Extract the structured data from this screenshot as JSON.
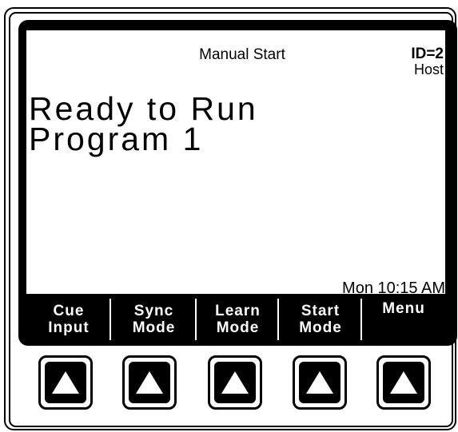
{
  "screen": {
    "title": "Manual Start",
    "id_label": "ID=2",
    "host_label": "Host",
    "message_line1": "Ready to Run",
    "message_line2": "Program 1",
    "status_time": "Mon 10:15 AM"
  },
  "softkeys": [
    {
      "line1": "Cue",
      "line2": "Input"
    },
    {
      "line1": "Sync",
      "line2": "Mode"
    },
    {
      "line1": "Learn",
      "line2": "Mode"
    },
    {
      "line1": "Start",
      "line2": "Mode"
    },
    {
      "line1": "Menu",
      "line2": ""
    }
  ],
  "buttons": [
    {
      "icon": "arrow-up-icon"
    },
    {
      "icon": "arrow-up-icon"
    },
    {
      "icon": "arrow-up-icon"
    },
    {
      "icon": "arrow-up-icon"
    },
    {
      "icon": "arrow-up-icon"
    }
  ]
}
